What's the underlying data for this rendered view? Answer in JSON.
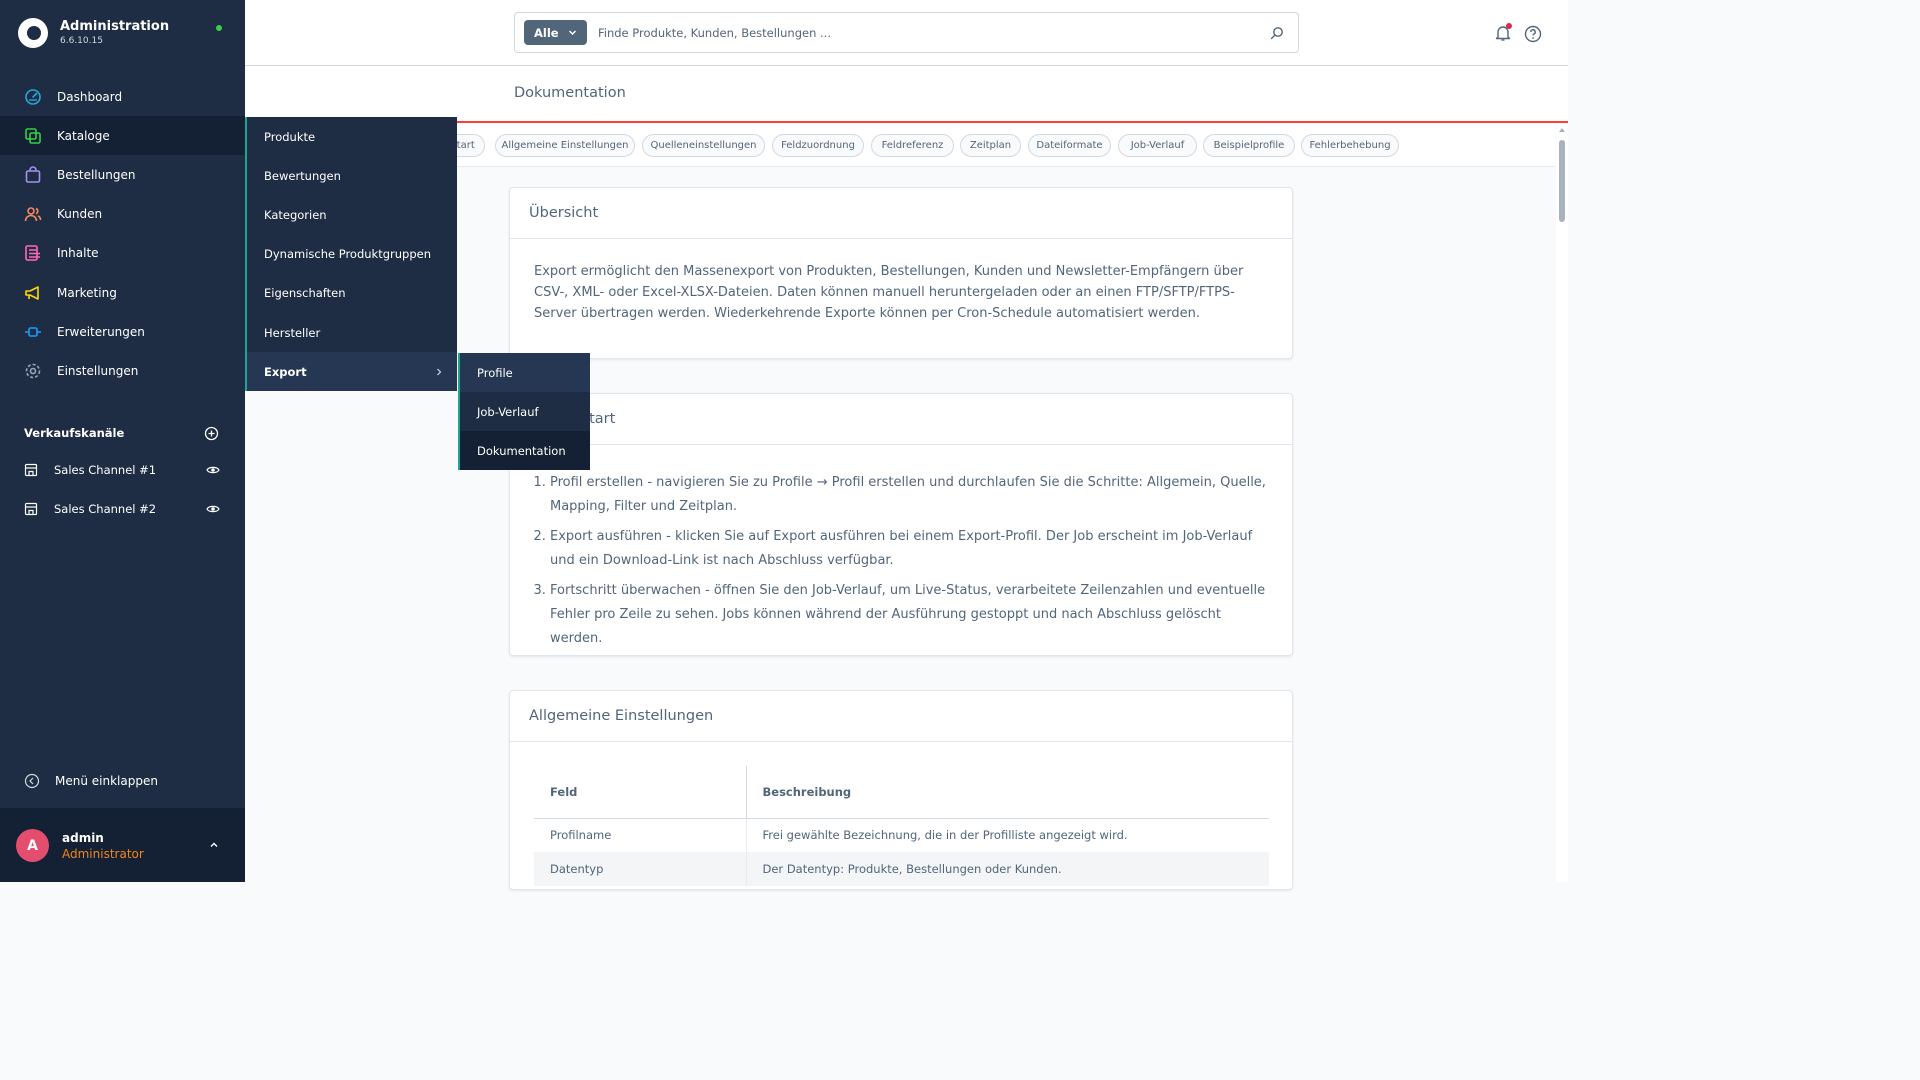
{
  "brand": {
    "title": "Administration",
    "version": "6.6.10.15"
  },
  "nav": [
    {
      "label": "Dashboard",
      "icon": "dashboard-icon",
      "color": "#23a8d9"
    },
    {
      "label": "Kataloge",
      "icon": "catalog-icon",
      "color": "#37d046"
    },
    {
      "label": "Bestellungen",
      "icon": "bag-icon",
      "color": "#a092f0"
    },
    {
      "label": "Kunden",
      "icon": "users-icon",
      "color": "#f88962"
    },
    {
      "label": "Inhalte",
      "icon": "content-icon",
      "color": "#ff68b4"
    },
    {
      "label": "Marketing",
      "icon": "megaphone-icon",
      "color": "#ffd700"
    },
    {
      "label": "Erweiterungen",
      "icon": "plug-icon",
      "color": "#189eff"
    },
    {
      "label": "Einstellungen",
      "icon": "gear-icon",
      "color": "#9aa8b5"
    }
  ],
  "sales_channels": {
    "title": "Verkaufskanäle",
    "items": [
      {
        "label": "Sales Channel #1"
      },
      {
        "label": "Sales Channel #2"
      }
    ]
  },
  "collapse_label": "Menü einklappen",
  "user": {
    "initial": "A",
    "name": "admin",
    "role": "Administrator"
  },
  "flyout": [
    {
      "label": "Produkte"
    },
    {
      "label": "Bewertungen"
    },
    {
      "label": "Kategorien"
    },
    {
      "label": "Dynamische Produktgruppen"
    },
    {
      "label": "Eigenschaften"
    },
    {
      "label": "Hersteller"
    },
    {
      "label": "Export"
    }
  ],
  "subflyout": [
    {
      "label": "Profile"
    },
    {
      "label": "Job-Verlauf"
    },
    {
      "label": "Dokumentation"
    }
  ],
  "search": {
    "type_label": "Alle",
    "placeholder": "Finde Produkte, Kunden, Bestellungen ..."
  },
  "page_title": "Dokumentation",
  "tabs": [
    {
      "label": "Schnellstart"
    },
    {
      "label": "Allgemeine Einstellungen"
    },
    {
      "label": "Quelleneinstellungen"
    },
    {
      "label": "Feldzuordnung"
    },
    {
      "label": "Feldreferenz"
    },
    {
      "label": "Zeitplan"
    },
    {
      "label": "Dateiformate"
    },
    {
      "label": "Job-Verlauf"
    },
    {
      "label": "Beispielprofile"
    },
    {
      "label": "Fehlerbehebung"
    }
  ],
  "overview": {
    "title": "Übersicht",
    "text": "Export ermöglicht den Massenexport von Produkten, Bestellungen, Kunden und Newsletter-Empfängern über CSV-, XML- oder Excel-XLSX-Dateien. Daten können manuell heruntergeladen oder an einen FTP/SFTP/FTPS-Server übertragen werden. Wiederkehrende Exporte können per Cron-Schedule automatisiert werden."
  },
  "quickstart": {
    "title": "Schnellstart",
    "steps": [
      "Profil erstellen - navigieren Sie zu Profile → Profil erstellen und durchlaufen Sie die Schritte: Allgemein, Quelle, Mapping, Filter und Zeitplan.",
      "Export ausführen - klicken Sie auf Export ausführen bei einem Export-Profil. Der Job erscheint im Job-Verlauf und ein Download-Link ist nach Abschluss verfügbar.",
      "Fortschritt überwachen - öffnen Sie den Job-Verlauf, um Live-Status, verarbeitete Zeilenzahlen und eventuelle Fehler pro Zeile zu sehen. Jobs können während der Ausführung gestoppt und nach Abschluss gelöscht werden."
    ]
  },
  "general": {
    "title": "Allgemeine Einstellungen",
    "headers": {
      "field": "Feld",
      "description": "Beschreibung"
    },
    "rows": [
      {
        "field": "Profilname",
        "description": "Frei gewählte Bezeichnung, die in der Profilliste angezeigt wird."
      },
      {
        "field": "Datentyp",
        "description": "Der Datentyp: Produkte, Bestellungen oder Kunden."
      }
    ]
  }
}
